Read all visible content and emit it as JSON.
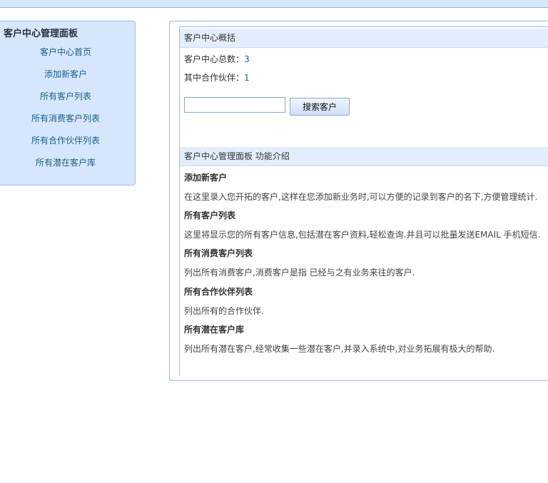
{
  "left_panel": {
    "title": "客户中心管理面板",
    "menu": [
      "客户中心首页",
      "添加新客户",
      "所有客户列表",
      "所有消费客户列表",
      "所有合作伙伴列表",
      "所有潜在客户库"
    ]
  },
  "overview": {
    "header": "客户中心概括",
    "total_label": "客户中心总数：",
    "total_value": "3",
    "partner_label": "其中合作伙伴：",
    "partner_value": "1"
  },
  "search": {
    "value": "",
    "button_label": "搜索客户"
  },
  "features": {
    "header": "客户中心管理面板 功能介绍",
    "items": [
      {
        "title": "添加新客户",
        "desc": "在这里录入您开拓的客户,这样在您添加新业务时,可以方便的记录到客户的名下,方便管理统计."
      },
      {
        "title": "所有客户列表",
        "desc": "这里将显示您的所有客户信息,包括潜在客户资料,轻松查询.并且可以批量发送EMAIL 手机短信."
      },
      {
        "title": "所有消费客户列表",
        "desc": "列出所有消费客户,消费客户是指 已经与之有业务来往的客户."
      },
      {
        "title": "所有合作伙伴列表",
        "desc": "列出所有的合作伙伴."
      },
      {
        "title": "所有潜在客户库",
        "desc": "列出所有潜在客户,经常收集一些潜在客户,并录入系统中,对业务拓展有极大的帮助."
      }
    ]
  }
}
